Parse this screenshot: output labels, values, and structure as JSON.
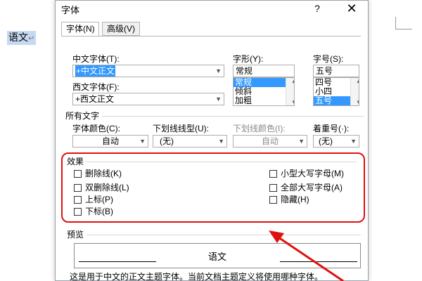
{
  "document": {
    "text": "语文",
    "paragraph_mark": "↵"
  },
  "dialog": {
    "title": "字体",
    "help": "?",
    "close": "✕",
    "tabs": [
      {
        "label": "字体(N)",
        "active": true
      },
      {
        "label": "高级(V)",
        "active": false
      }
    ]
  },
  "font": {
    "chinese_label": "中文字体(T):",
    "chinese_value": "+中文正文",
    "western_label": "西文字体(F):",
    "western_value": "+西文正文",
    "style_label": "字形(Y):",
    "style_value": "常规",
    "style_options": [
      "常规",
      "倾斜",
      "加粗"
    ],
    "style_selected": "常规",
    "size_label": "字号(S):",
    "size_value": "五号",
    "size_options": [
      "四号",
      "小四",
      "五号"
    ],
    "size_selected": "五号"
  },
  "all_text": {
    "section_label": "所有文字",
    "color_label": "字体颜色(C):",
    "color_value": "自动",
    "underline_label": "下划线线型(U):",
    "underline_value": "(无)",
    "underline_color_label": "下划线颜色(I):",
    "underline_color_value": "自动",
    "emphasis_label": "着重号(·):",
    "emphasis_value": "(无)"
  },
  "effects": {
    "section_label": "效果",
    "left": [
      {
        "label": "删除线(K)",
        "checked": false
      },
      {
        "label": "双删除线(L)",
        "checked": false
      },
      {
        "label": "上标(P)",
        "checked": false
      },
      {
        "label": "下标(B)",
        "checked": false
      }
    ],
    "right": [
      {
        "label": "小型大写字母(M)",
        "checked": false
      },
      {
        "label": "全部大写字母(A)",
        "checked": false
      },
      {
        "label": "隐藏(H)",
        "checked": false
      }
    ]
  },
  "preview": {
    "section_label": "预览",
    "sample_text": "语文",
    "description": "这是用于中文的正文主题字体。当前文档主题定义将使用哪种字体。"
  },
  "colors": {
    "highlight_red": "#e01010",
    "selection_blue": "#3399ff"
  }
}
